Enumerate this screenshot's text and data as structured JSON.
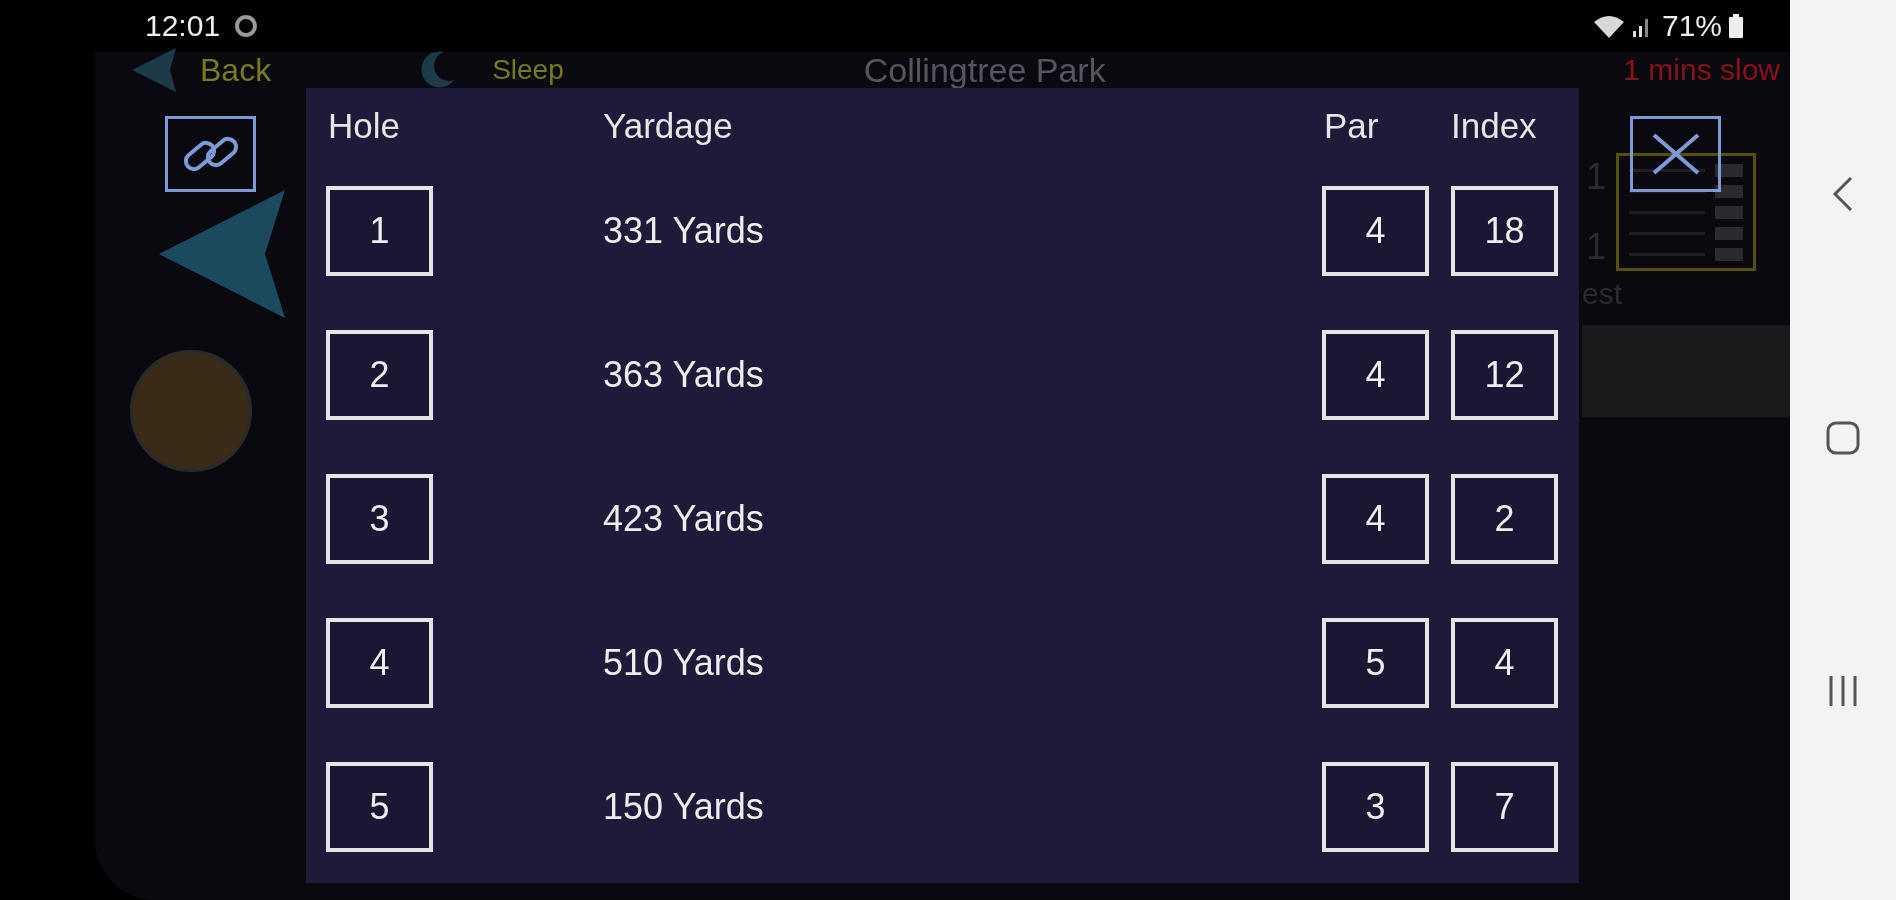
{
  "status_bar": {
    "time": "12:01",
    "battery": "71%"
  },
  "header": {
    "back": "Back",
    "sleep": "Sleep",
    "title": "Collingtree Park",
    "pace": "1 mins slow"
  },
  "side": {
    "values": [
      "1",
      "1"
    ],
    "label": "est"
  },
  "scorecard": {
    "columns": [
      "Hole",
      "Yardage",
      "Par",
      "Index"
    ],
    "rows": [
      {
        "hole": "1",
        "yardage": "331 Yards",
        "par": "4",
        "index": "18"
      },
      {
        "hole": "2",
        "yardage": "363 Yards",
        "par": "4",
        "index": "12"
      },
      {
        "hole": "3",
        "yardage": "423 Yards",
        "par": "4",
        "index": "2"
      },
      {
        "hole": "4",
        "yardage": "510 Yards",
        "par": "5",
        "index": "4"
      },
      {
        "hole": "5",
        "yardage": "150 Yards",
        "par": "3",
        "index": "7"
      }
    ]
  }
}
